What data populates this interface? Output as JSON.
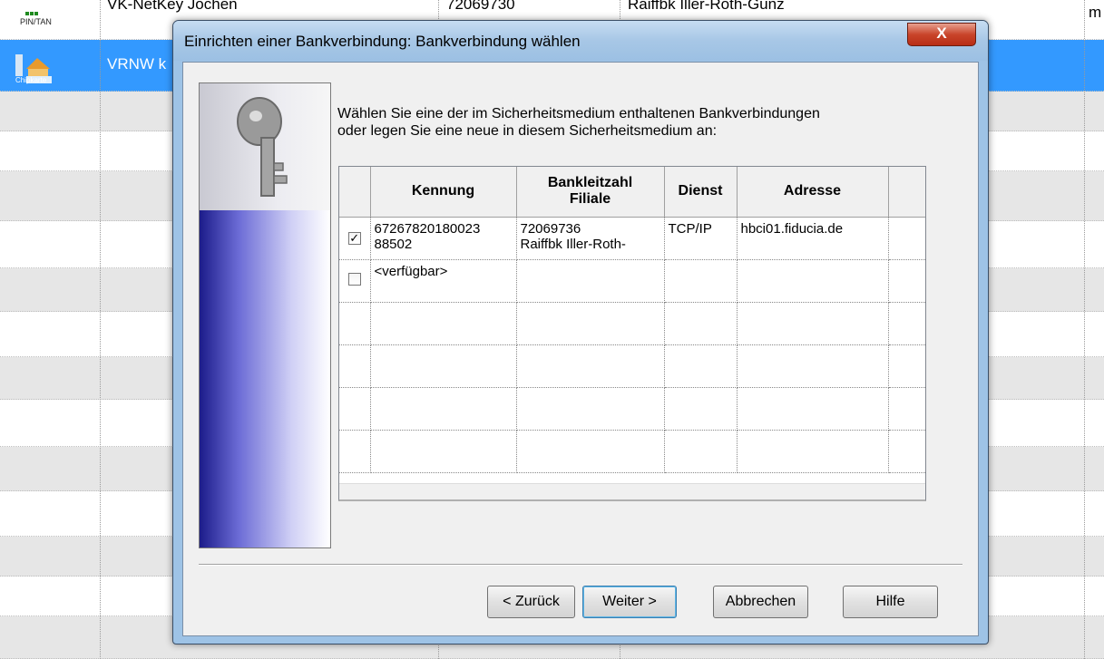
{
  "background": {
    "top_row": {
      "name": "VK-NetKey Jochen",
      "code": "72069730",
      "bank": "Raiffbk Iller-Roth-Günz",
      "right": "m"
    },
    "selected_row": {
      "name": "VRNW k"
    },
    "pin_label": "PIN/TAN",
    "chip_label": "Chipkarte"
  },
  "dialog": {
    "title": "Einrichten einer Bankverbindung: Bankverbindung wählen",
    "close_label": "X",
    "instruction_line1": "Wählen Sie eine der im Sicherheitsmedium enthaltenen Bankverbindungen",
    "instruction_line2": "oder legen Sie eine neue in diesem Sicherheitsmedium an:",
    "table": {
      "headers": {
        "kennung": "Kennung",
        "blz_line1": "Bankleitzahl",
        "blz_line2": "Filiale",
        "dienst": "Dienst",
        "adresse": "Adresse"
      },
      "rows": [
        {
          "checked": "✓",
          "kennung_line1": "67267820180023",
          "kennung_line2": "88502",
          "blz_line1": "72069736",
          "blz_line2": "Raiffbk Iller-Roth-",
          "dienst": "TCP/IP",
          "adresse": "hbci01.fiducia.de"
        },
        {
          "checked": "",
          "kennung_line1": "<verfügbar>",
          "kennung_line2": "",
          "blz_line1": "",
          "blz_line2": "",
          "dienst": "",
          "adresse": ""
        }
      ]
    },
    "buttons": {
      "back": "< Zurück",
      "next": "Weiter >",
      "cancel": "Abbrechen",
      "help": "Hilfe"
    }
  },
  "colors": {
    "selection": "#3399ff",
    "titlebar": "#a7c7e6",
    "close": "#c9452b"
  }
}
